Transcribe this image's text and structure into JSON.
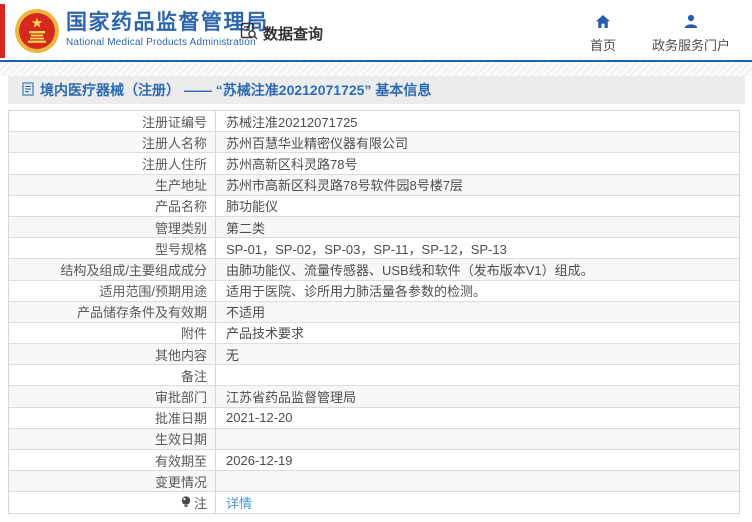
{
  "colors": {
    "accent_blue": "#2d66ae",
    "header_rule_blue": "#1e62a9",
    "brand_red": "#d6281e",
    "link_blue": "#4a90d9",
    "breadcrumb_bg": "#ececec",
    "alt_row_bg": "#f7f7f7"
  },
  "header": {
    "emblem_icon": "china-national-emblem",
    "org_name_cn": "国家药品监督管理局",
    "org_name_en": "National Medical Products Administration",
    "data_query": {
      "icon": "document-search-icon",
      "label": "数据查询"
    },
    "nav_items": [
      {
        "icon": "home-icon",
        "label": "首页"
      },
      {
        "icon": "user-icon",
        "label": "政务服务门户"
      }
    ]
  },
  "breadcrumb": {
    "icon": "document-icon",
    "text": "境内医疗器械（注册） —— “苏械注准20212071725” 基本信息"
  },
  "table": {
    "rows": [
      {
        "label": "注册证编号",
        "value": "苏械注准20212071725"
      },
      {
        "label": "注册人名称",
        "value": "苏州百慧华业精密仪器有限公司"
      },
      {
        "label": "注册人住所",
        "value": "苏州高新区科灵路78号"
      },
      {
        "label": "生产地址",
        "value": "苏州市高新区科灵路78号软件园8号楼7层"
      },
      {
        "label": "产品名称",
        "value": "肺功能仪"
      },
      {
        "label": "管理类别",
        "value": "第二类"
      },
      {
        "label": "型号规格",
        "value": "SP-01，SP-02，SP-03，SP-11，SP-12，SP-13"
      },
      {
        "label": "结构及组成/主要组成成分",
        "value": "由肺功能仪、流量传感器、USB线和软件（发布版本V1）组成。"
      },
      {
        "label": "适用范围/预期用途",
        "value": "适用于医院、诊所用力肺活量各参数的检测。"
      },
      {
        "label": "产品储存条件及有效期",
        "value": "不适用"
      },
      {
        "label": "附件",
        "value": "产品技术要求"
      },
      {
        "label": "其他内容",
        "value": "无"
      },
      {
        "label": "备注",
        "value": ""
      },
      {
        "label": "审批部门",
        "value": "江苏省药品监督管理局"
      },
      {
        "label": "批准日期",
        "value": "2021-12-20"
      },
      {
        "label": "生效日期",
        "value": ""
      },
      {
        "label": "有效期至",
        "value": "2026-12-19"
      },
      {
        "label": "变更情况",
        "value": ""
      },
      {
        "label": "注",
        "icon": "note-bulb-icon",
        "value": "详情",
        "link": true
      }
    ]
  }
}
